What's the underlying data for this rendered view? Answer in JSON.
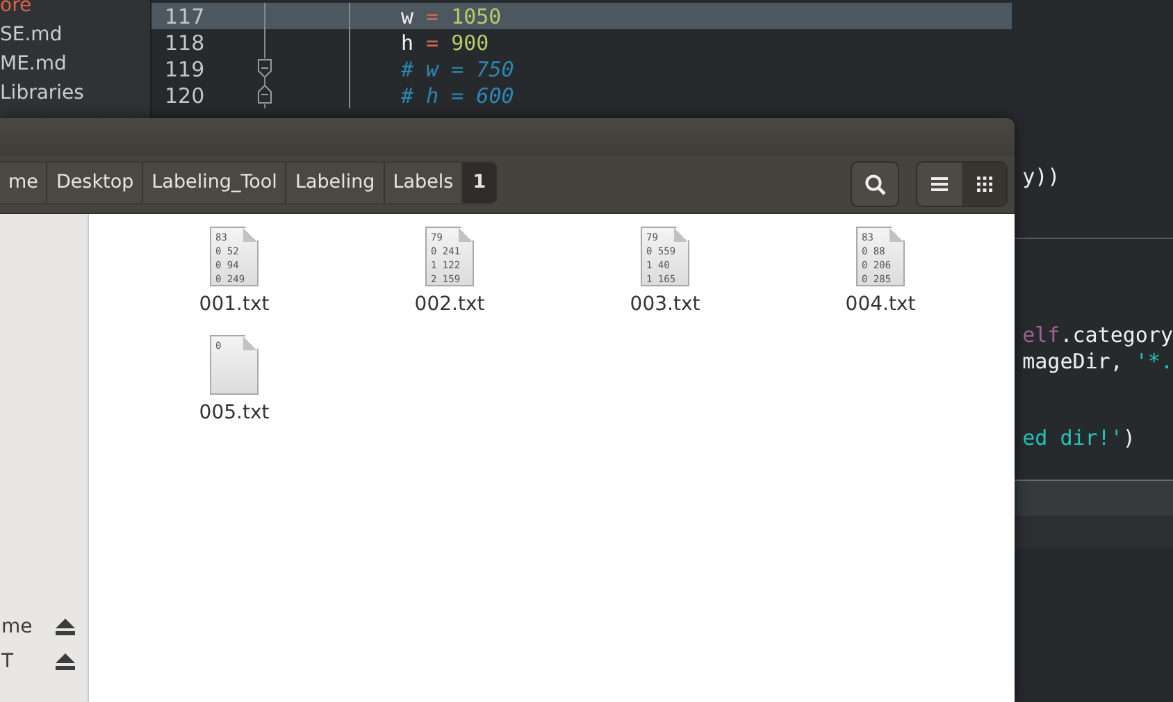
{
  "editor": {
    "sidebar_items": [
      {
        "label": "ore",
        "modified": true
      },
      {
        "label": "SE.md",
        "modified": false
      },
      {
        "label": "ME.md",
        "modified": false
      },
      {
        "label": "Libraries",
        "modified": false
      }
    ],
    "lines": [
      {
        "number": "117",
        "current": true,
        "fold": false,
        "tokens": [
          {
            "kind": "plain",
            "text": "w"
          },
          {
            "kind": "operator",
            "text": "="
          },
          {
            "kind": "number",
            "text": "1050"
          }
        ]
      },
      {
        "number": "118",
        "current": false,
        "fold": false,
        "tokens": [
          {
            "kind": "plain",
            "text": "h"
          },
          {
            "kind": "operator",
            "text": "="
          },
          {
            "kind": "number",
            "text": "900"
          }
        ]
      },
      {
        "number": "119",
        "current": false,
        "fold": true,
        "tokens": [
          {
            "kind": "comment",
            "text": "# w = 750"
          }
        ]
      },
      {
        "number": "120",
        "current": false,
        "fold": true,
        "tokens": [
          {
            "kind": "comment",
            "text": "# h = 600"
          }
        ]
      }
    ],
    "right_lines": [
      {
        "tokens": [
          {
            "kind": "plain",
            "text": "y))"
          }
        ]
      },
      {
        "tokens": [
          {
            "kind": "keyword",
            "text": "elf"
          },
          {
            "kind": "plain",
            "text": ".category"
          }
        ]
      },
      {
        "tokens": [
          {
            "kind": "plain",
            "text": "mageDir, "
          },
          {
            "kind": "string",
            "text": "'*."
          }
        ]
      },
      {
        "tokens": [
          {
            "kind": "string",
            "text": "ed dir!'"
          },
          {
            "kind": "plain",
            "text": ")"
          }
        ]
      }
    ]
  },
  "file_manager": {
    "breadcrumbs": [
      {
        "label": "me",
        "selected": false
      },
      {
        "label": "Desktop",
        "selected": false
      },
      {
        "label": "Labeling_Tool",
        "selected": false
      },
      {
        "label": "Labeling",
        "selected": false
      },
      {
        "label": "Labels",
        "selected": false
      },
      {
        "label": "1",
        "selected": true
      }
    ],
    "views": [
      {
        "kind": "list",
        "selected": false
      },
      {
        "kind": "grid",
        "selected": true
      }
    ],
    "sidebar_items": [
      {
        "label": "me"
      },
      {
        "label": "T"
      }
    ],
    "files": [
      {
        "name": "001.txt",
        "preview": [
          "83",
          "0 52",
          "0 94",
          "0 249"
        ]
      },
      {
        "name": "002.txt",
        "preview": [
          "79",
          "0 241",
          "1 122",
          "2 159"
        ]
      },
      {
        "name": "003.txt",
        "preview": [
          "79",
          "0 559",
          "1 40",
          "1 165"
        ]
      },
      {
        "name": "004.txt",
        "preview": [
          "83",
          "0 88",
          "0 206",
          "0 285"
        ]
      },
      {
        "name": "005.txt",
        "preview": [
          "0"
        ]
      }
    ]
  }
}
